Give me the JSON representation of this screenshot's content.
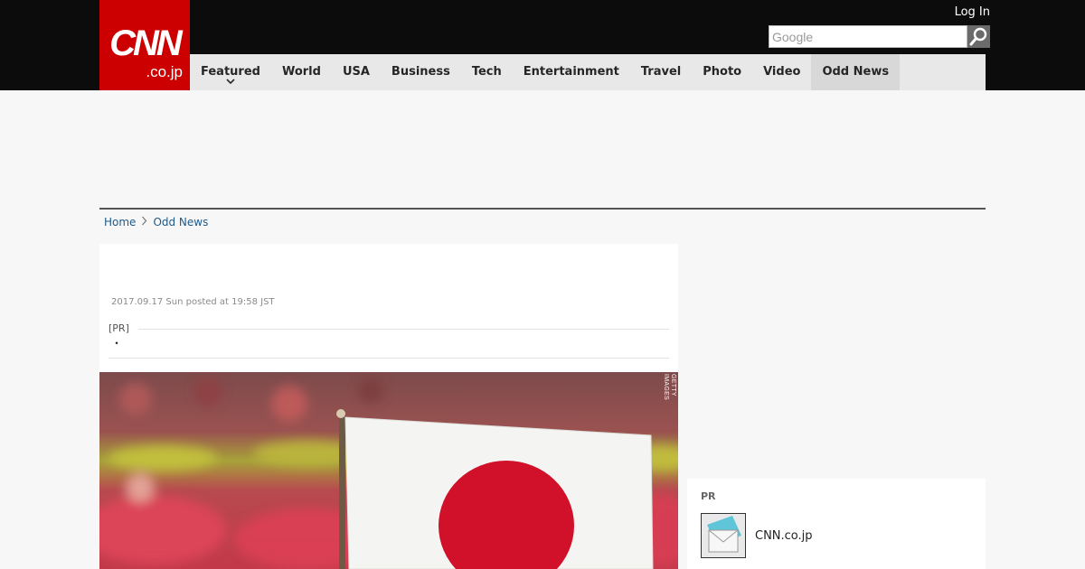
{
  "header": {
    "logo_main": "CNN",
    "logo_sub": ".co.jp",
    "login_label": "Log In",
    "search": {
      "placeholder": "Google",
      "value": ""
    }
  },
  "nav": {
    "items": [
      {
        "label": "Featured",
        "has_dropdown": true
      },
      {
        "label": "World"
      },
      {
        "label": "USA"
      },
      {
        "label": "Business"
      },
      {
        "label": "Tech"
      },
      {
        "label": "Entertainment"
      },
      {
        "label": "Travel"
      },
      {
        "label": "Photo"
      },
      {
        "label": "Video"
      },
      {
        "label": "Odd News",
        "active": true
      }
    ]
  },
  "breadcrumb": {
    "home": "Home",
    "current": "Odd News"
  },
  "article": {
    "posted": "2017.09.17 Sun posted at 19:58 JST",
    "pr_tag": "[PR]",
    "pr_text": "・",
    "image_credit": "GETTY IMAGES"
  },
  "sidebar": {
    "pr_title": "PR",
    "pr_item_label": "CNN.co.jp"
  },
  "colors": {
    "brand_red": "#cc0000",
    "topbar": "#0c0c0c",
    "nav_bg": "#e8e8e8",
    "nav_active": "#d8d8d8",
    "link": "#1d5a8a"
  }
}
